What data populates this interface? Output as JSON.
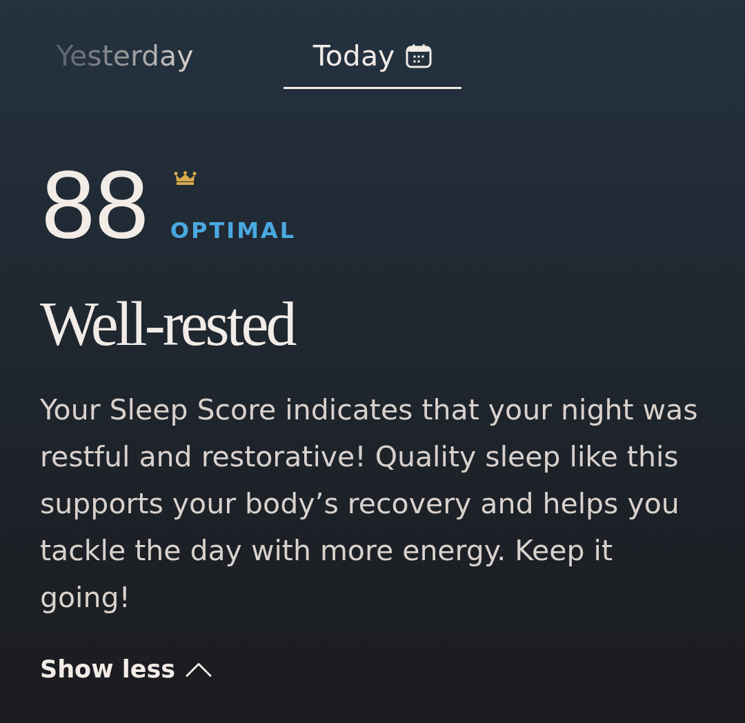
{
  "tabs": [
    {
      "label": "Yesterday",
      "selected": false
    },
    {
      "label": "Today",
      "selected": true
    }
  ],
  "score": {
    "value": "88",
    "rating": "OPTIMAL"
  },
  "headline": "Well-rested",
  "description": "Your Sleep Score indicates that your night was restful and restorative! Quality sleep like this supports your body’s recovery and helps you tackle the day with more energy. Keep it going!",
  "toggle": {
    "label": "Show less",
    "expanded": true
  }
}
